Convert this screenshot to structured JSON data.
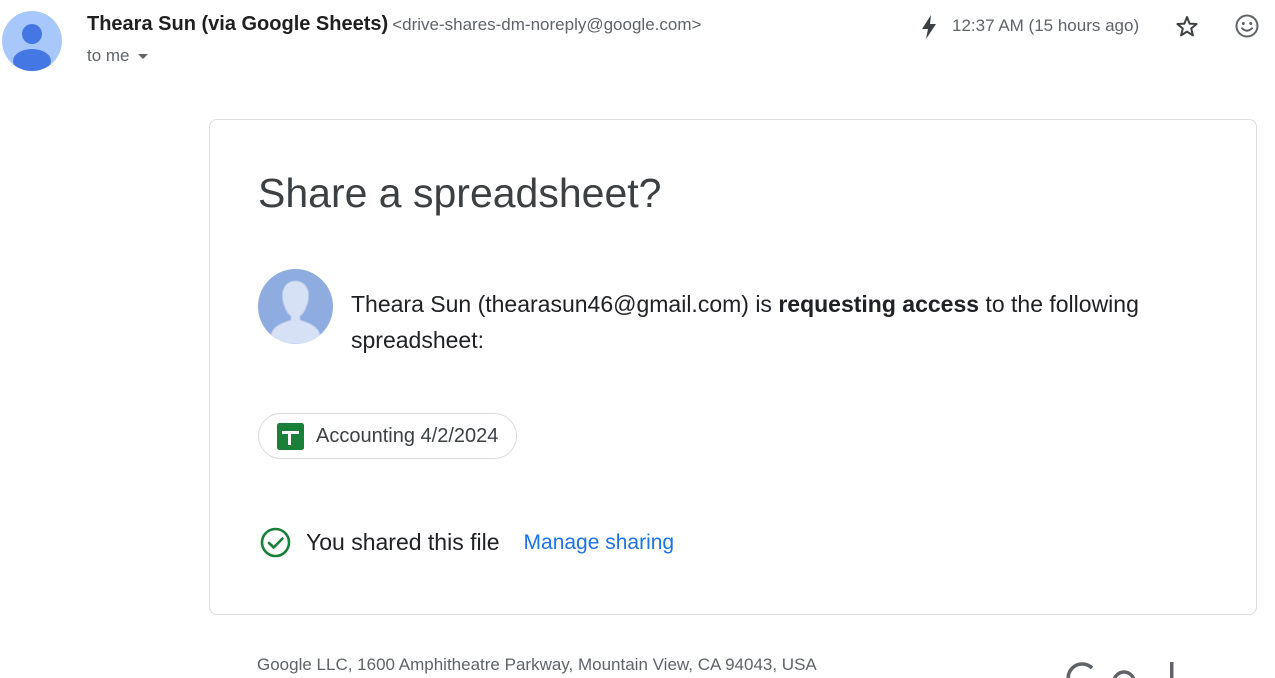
{
  "header": {
    "sender_name": "Theara Sun (via Google Sheets)",
    "sender_email": "<drive-shares-dm-noreply@google.com>",
    "recipient_label": "to me",
    "timestamp": "12:37 AM (15 hours ago)"
  },
  "icons": {
    "sender_avatar": "person-icon",
    "importance": "lightning-bolt-icon",
    "star": "star-icon",
    "emoji_reaction": "smiley-icon",
    "requester_avatar": "person-silhouette-icon",
    "file_type": "google-sheets-icon",
    "shared_status": "check-circle-icon"
  },
  "card": {
    "title": "Share a spreadsheet?",
    "request_prefix": "Theara Sun (thearasun46@gmail.com) is ",
    "request_bold": "requesting access",
    "request_suffix": " to the following spreadsheet:",
    "file_name": "Accounting 4/2/2024",
    "shared_status": "You shared this file",
    "manage_link": "Manage sharing"
  },
  "footer": {
    "address": "Google LLC, 1600 Amphitheatre Parkway, Mountain View, CA 94043, USA"
  },
  "colors": {
    "link": "#1a73e8",
    "sheets_green": "#188038",
    "check_green": "#188038",
    "avatar_blue": "#a8c7fa",
    "avatar_person": "#4477e4"
  }
}
